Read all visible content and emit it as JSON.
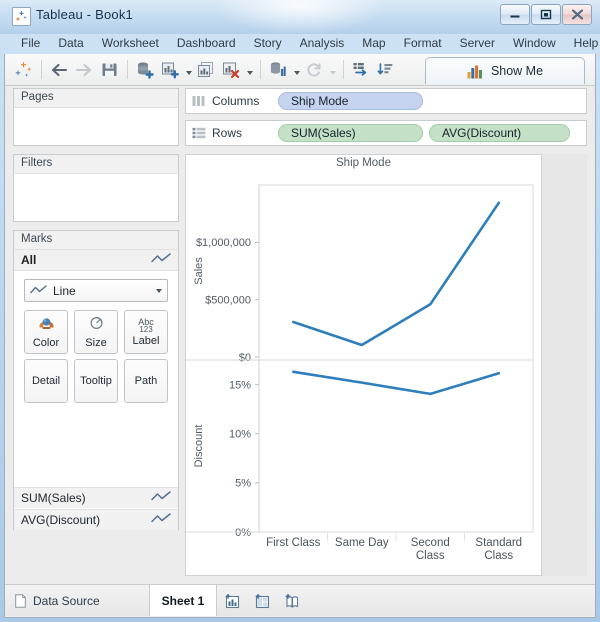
{
  "window": {
    "title": "Tableau - Book1",
    "app_icon": "tableau-logo-icon",
    "controls": [
      {
        "name": "minimize",
        "glyph": "–"
      },
      {
        "name": "maximize",
        "glyph": "□"
      },
      {
        "name": "close",
        "glyph": "✕"
      }
    ]
  },
  "menubar": {
    "items": [
      {
        "label": "File"
      },
      {
        "label": "Data"
      },
      {
        "label": "Worksheet"
      },
      {
        "label": "Dashboard"
      },
      {
        "label": "Story"
      },
      {
        "label": "Analysis"
      },
      {
        "label": "Map"
      },
      {
        "label": "Format"
      },
      {
        "label": "Server"
      },
      {
        "label": "Window"
      },
      {
        "label": "Help"
      }
    ]
  },
  "toolbar": {
    "buttons": [
      {
        "name": "tableau-home-icon",
        "tooltip": "Tableau"
      },
      {
        "name": "back-arrow-icon",
        "tooltip": "Undo"
      },
      {
        "name": "forward-arrow-icon",
        "tooltip": "Redo"
      },
      {
        "name": "save-icon",
        "tooltip": "Save"
      },
      {
        "name": "new-data-source-icon",
        "tooltip": "Connect to Data"
      },
      {
        "name": "new-worksheet-icon",
        "tooltip": "New Worksheet"
      },
      {
        "name": "duplicate-sheet-icon",
        "tooltip": "Duplicate Sheet"
      },
      {
        "name": "clear-sheet-icon",
        "tooltip": "Clear Sheet"
      },
      {
        "name": "totals-icon",
        "tooltip": "Totals"
      },
      {
        "name": "refresh-icon",
        "tooltip": "Refresh Data Source"
      },
      {
        "name": "swap-axes-icon",
        "tooltip": "Swap Rows and Columns"
      },
      {
        "name": "sort-descending-icon",
        "tooltip": "Sort Descending"
      }
    ],
    "show_me": {
      "label": "Show Me",
      "icon": "show-me-bar-chart-icon"
    }
  },
  "left_panel": {
    "pages": {
      "title": "Pages"
    },
    "filters": {
      "title": "Filters"
    },
    "marks": {
      "title": "Marks",
      "all_label": "All",
      "all_icon": "line-mark-icon",
      "mark_type": "Line",
      "mark_type_icon": "line-mark-icon",
      "buttons": [
        {
          "label": "Color",
          "icon": "color-palette-icon"
        },
        {
          "label": "Size",
          "icon": "size-circle-icon"
        },
        {
          "label": "Label",
          "icon": "abc-123-icon"
        },
        {
          "label": "Detail",
          "icon": ""
        },
        {
          "label": "Tooltip",
          "icon": ""
        },
        {
          "label": "Path",
          "icon": ""
        }
      ],
      "measure_rows": [
        {
          "label": "SUM(Sales)",
          "icon": "line-mark-icon"
        },
        {
          "label": "AVG(Discount)",
          "icon": "line-mark-icon"
        }
      ]
    }
  },
  "shelves": {
    "columns": {
      "label": "Columns",
      "icon": "columns-icon",
      "pills": [
        {
          "label": "Ship Mode",
          "kind": "dimension"
        }
      ]
    },
    "rows": {
      "label": "Rows",
      "icon": "rows-icon",
      "pills": [
        {
          "label": "SUM(Sales)",
          "kind": "measure"
        },
        {
          "label": "AVG(Discount)",
          "kind": "measure"
        }
      ]
    }
  },
  "colors": {
    "line": "#2e7ebb",
    "dimension_pill": "#c5d3ef",
    "measure_pill": "#c4e0c6",
    "axis_text": "#515b66"
  },
  "chart_data": [
    {
      "type": "line",
      "title": "Ship Mode",
      "panel": "sales",
      "xlabel": "",
      "ylabel": "Sales",
      "categories": [
        "First Class",
        "Same Day",
        "Second Class",
        "Standard Class"
      ],
      "values": [
        305000,
        105000,
        460000,
        1345000
      ],
      "ytick_labels": [
        "$1,000,000",
        "$500,000",
        "$0"
      ],
      "ytick_values": [
        1000000,
        500000,
        0
      ],
      "ylim": [
        0,
        1500000
      ],
      "grid": false,
      "legend": "none",
      "series_color": "#2e7ebb"
    },
    {
      "type": "line",
      "title": "Ship Mode",
      "panel": "discount",
      "xlabel": "",
      "ylabel": "Discount",
      "categories": [
        "First Class",
        "Same Day",
        "Second Class",
        "Standard Class"
      ],
      "values": [
        0.163,
        0.152,
        0.1405,
        0.1615
      ],
      "ytick_labels": [
        "15%",
        "10%",
        "5%",
        "0%"
      ],
      "ytick_values": [
        0.15,
        0.1,
        0.05,
        0
      ],
      "ylim": [
        0,
        0.175
      ],
      "grid": false,
      "legend": "none",
      "series_color": "#2e7ebb"
    }
  ],
  "bottom_bar": {
    "data_source": {
      "label": "Data Source",
      "icon": "data-source-icon"
    },
    "sheet_tab": {
      "label": "Sheet 1"
    },
    "new_buttons": [
      {
        "name": "new-worksheet-icon"
      },
      {
        "name": "new-dashboard-icon"
      },
      {
        "name": "new-story-icon"
      }
    ]
  }
}
